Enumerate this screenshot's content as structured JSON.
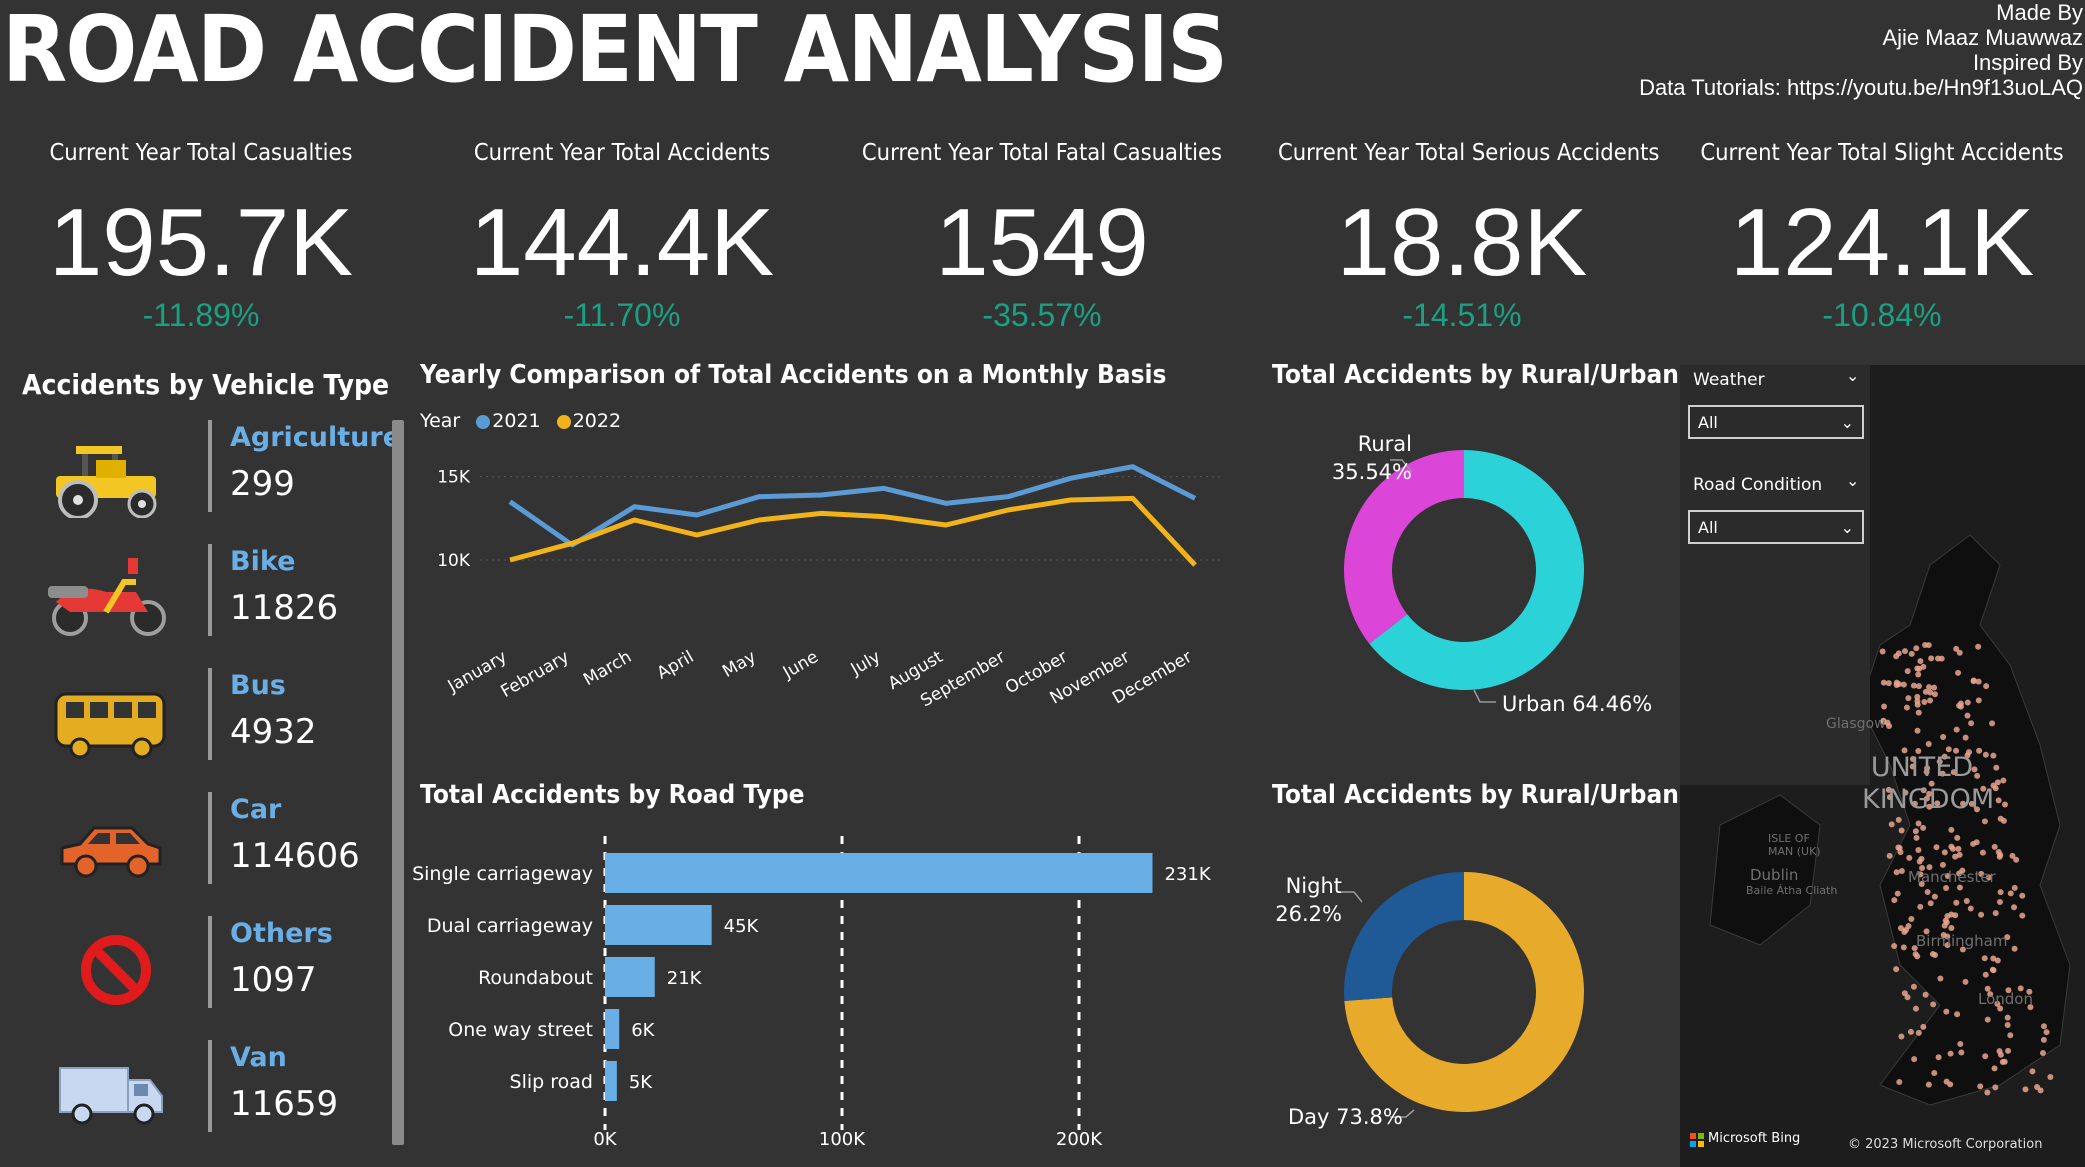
{
  "header": {
    "title": "ROAD ACCIDENT ANALYSIS",
    "credits": [
      "Made By",
      "Ajie Maaz Muawwaz",
      "Inspired By",
      "Data Tutorials: https://youtu.be/Hn9f13uoLAQ"
    ]
  },
  "kpis": [
    {
      "label": "Current Year Total Casualties",
      "value": "195.7K",
      "change": "-11.89%"
    },
    {
      "label": "Current Year Total Accidents",
      "value": "144.4K",
      "change": "-11.70%"
    },
    {
      "label": "Current Year Total Fatal Casualties",
      "value": "1549",
      "change": "-35.57%"
    },
    {
      "label": "Current Year Total Serious Accidents",
      "value": "18.8K",
      "change": "-14.51%"
    },
    {
      "label": "Current Year Total Slight Accidents",
      "value": "124.1K",
      "change": "-10.84%"
    }
  ],
  "vehicles": {
    "title": "Accidents by Vehicle Type",
    "items": [
      {
        "name": "Agriculture",
        "value": "299",
        "icon": "tractor-icon"
      },
      {
        "name": "Bike",
        "value": "11826",
        "icon": "motorbike-icon"
      },
      {
        "name": "Bus",
        "value": "4932",
        "icon": "bus-icon"
      },
      {
        "name": "Car",
        "value": "114606",
        "icon": "car-icon"
      },
      {
        "name": "Others",
        "value": "1097",
        "icon": "no-entry-icon"
      },
      {
        "name": "Van",
        "value": "11659",
        "icon": "van-icon"
      }
    ]
  },
  "monthly": {
    "title": "Yearly Comparison of Total Accidents on a Monthly Basis",
    "legend_title": "Year",
    "colors": {
      "2021": "#5b9bd5",
      "2022": "#f2b21a"
    }
  },
  "road": {
    "title": "Total Accidents by Road Type",
    "color": "#6aaee6"
  },
  "rural": {
    "title": "Total Accidents by Rural/Urban",
    "rural_label": "Rural",
    "rural_pct": "35.54%",
    "urban_label": "Urban 64.46%",
    "colors": {
      "rural": "#db45d8",
      "urban": "#2bd3d8"
    }
  },
  "daynight": {
    "title": "Total Accidents by Rural/Urban",
    "night_label": "Night",
    "night_pct": "26.2%",
    "day_label": "Day 73.8%",
    "colors": {
      "night": "#1f5a96",
      "day": "#e8aa2a"
    }
  },
  "filters": {
    "weather_label": "Weather",
    "weather_value": "All",
    "road_condition_label": "Road Condition",
    "road_condition_value": "All"
  },
  "map": {
    "country": [
      "UNITED",
      "KINGDOM"
    ],
    "places": [
      "Glasgow",
      "ISLE OF MAN (UK)",
      "Dublin",
      "Baile Átha Cliath",
      "Manchester",
      "Birmingham",
      "London"
    ],
    "bing": "Microsoft Bing",
    "copyright": "© 2023 Microsoft Corporation"
  },
  "chart_data": [
    {
      "type": "line",
      "title": "Yearly Comparison of Total Accidents on a Monthly Basis",
      "categories": [
        "January",
        "February",
        "March",
        "April",
        "May",
        "June",
        "July",
        "August",
        "September",
        "October",
        "November",
        "December"
      ],
      "y_ticks": [
        "10K",
        "15K"
      ],
      "ylim": [
        7000,
        16000
      ],
      "series": [
        {
          "name": "2021",
          "values": [
            13500,
            10900,
            13200,
            12700,
            13800,
            13900,
            14300,
            13400,
            13800,
            14900,
            15600,
            13700
          ]
        },
        {
          "name": "2022",
          "values": [
            10000,
            11000,
            12400,
            11500,
            12400,
            12800,
            12600,
            12100,
            13000,
            13600,
            13700,
            9700
          ]
        }
      ],
      "legend": "top-left",
      "grid": true
    },
    {
      "type": "bar",
      "orientation": "horizontal",
      "title": "Total Accidents by Road Type",
      "categories": [
        "Single carriageway",
        "Dual carriageway",
        "Roundabout",
        "One way street",
        "Slip road"
      ],
      "values": [
        231000,
        45000,
        21000,
        6000,
        5000
      ],
      "data_labels": [
        "231K",
        "45K",
        "21K",
        "6K",
        "5K"
      ],
      "x_ticks": [
        "0K",
        "100K",
        "200K"
      ],
      "xlim": [
        0,
        250000
      ]
    },
    {
      "type": "pie",
      "donut": true,
      "title": "Total Accidents by Rural/Urban",
      "categories": [
        "Urban",
        "Rural"
      ],
      "values": [
        64.46,
        35.54
      ]
    },
    {
      "type": "pie",
      "donut": true,
      "title": "Total Accidents by Rural/Urban",
      "categories": [
        "Day",
        "Night"
      ],
      "values": [
        73.8,
        26.2
      ]
    }
  ]
}
